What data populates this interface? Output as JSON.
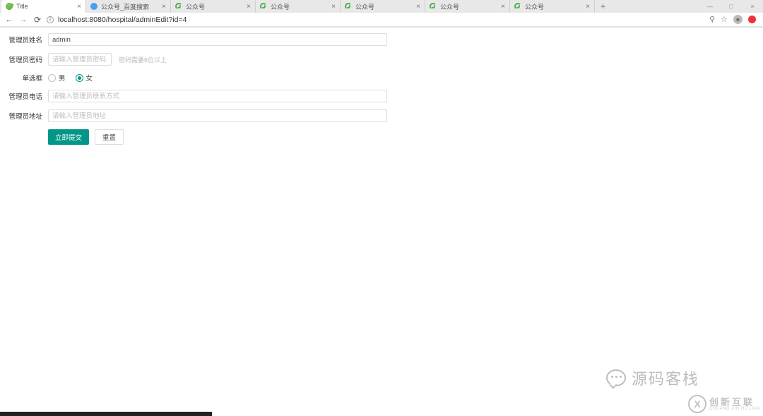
{
  "window": {
    "minimize": "—",
    "maximize": "□",
    "close": "×"
  },
  "tabs": [
    {
      "title": "Title",
      "icon": "leaf"
    },
    {
      "title": "公众号_百度搜索",
      "icon": "gear"
    },
    {
      "title": "公众号",
      "icon": "swirl"
    },
    {
      "title": "公众号",
      "icon": "swirl"
    },
    {
      "title": "公众号",
      "icon": "swirl"
    },
    {
      "title": "公众号",
      "icon": "swirl"
    },
    {
      "title": "公众号",
      "icon": "swirl"
    }
  ],
  "new_tab": "+",
  "url": "localhost:8080/hospital/adminEdit?id=4",
  "toolbar_icons": {
    "search": "⚲",
    "star": "☆"
  },
  "form": {
    "name_label": "管理员姓名",
    "name_value": "admin",
    "password_label": "管理员密码",
    "password_placeholder": "请输入管理员密码",
    "password_hint": "密码需要6位以上",
    "radio_label": "单选框",
    "radio_options": [
      {
        "text": "男",
        "checked": false
      },
      {
        "text": "女",
        "checked": true
      }
    ],
    "phone_label": "管理员电话",
    "phone_placeholder": "请输入管理员联系方式",
    "address_label": "管理员地址",
    "address_placeholder": "请输入管理员地址",
    "submit_label": "立即提交",
    "reset_label": "重置"
  },
  "watermark": {
    "wechat_text": "源码客栈",
    "logo_cn": "创新互联",
    "logo_en": "CHUANG XIN HU LIAN",
    "logo_mark": "X"
  }
}
